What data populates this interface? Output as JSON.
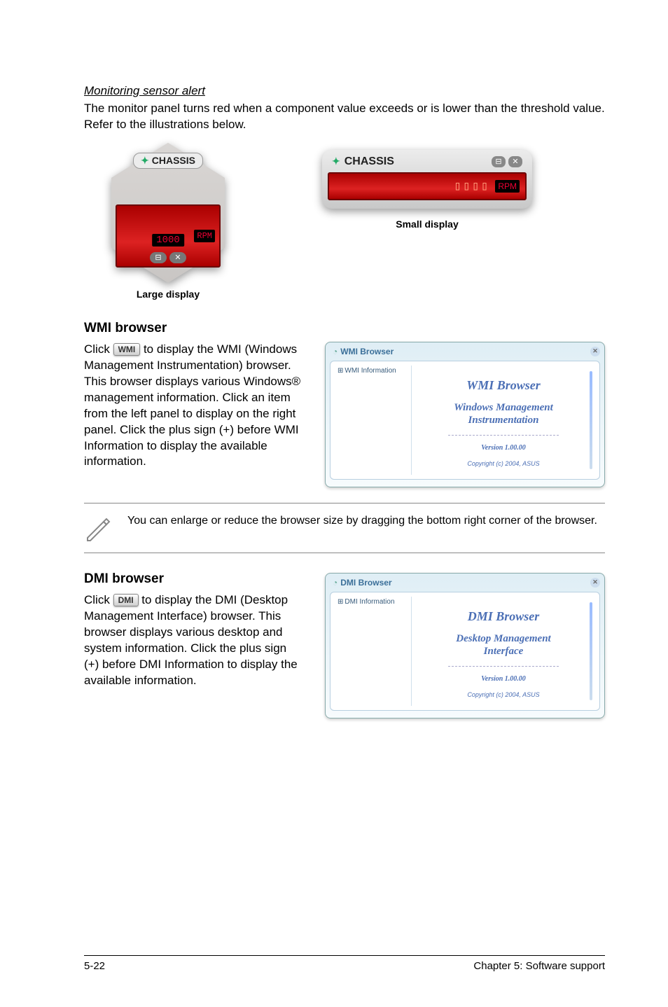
{
  "monitoring": {
    "heading": "Monitoring sensor alert",
    "desc": "The monitor panel turns red when a component value exceeds or is lower than the threshold value. Refer to the illustrations below.",
    "large_label": "CHASSIS",
    "large_rpm_label": "RPM",
    "large_value": "1000",
    "large_caption": "Large display",
    "small_label": "CHASSIS",
    "small_rpm_label": "RPM",
    "small_caption": "Small display"
  },
  "wmi": {
    "heading": "WMI browser",
    "desc1": "Click ",
    "btn": "WMI",
    "desc2": " to display the WMI (Windows Management Instrumentation) browser. This browser displays various Windows® management information. Click an item from the left panel to display on the right panel. Click the plus sign (+) before WMI Information to display the available information.",
    "shot_title": "WMI Browser",
    "tree_root": "WMI Information",
    "main_title": "WMI Browser",
    "main_sub": "Windows Management\nInstrumentation",
    "version": "Version 1.00.00",
    "copyright": "Copyright (c) 2004, ASUS"
  },
  "note": {
    "text": "You can enlarge or reduce the browser size by dragging the bottom right corner of the browser."
  },
  "dmi": {
    "heading": "DMI browser",
    "desc1": "Click ",
    "btn": "DMI",
    "desc2": " to display the DMI (Desktop Management Interface) browser. This browser displays various desktop and system information. Click the plus sign (+) before DMI Information to display the available information.",
    "shot_title": "DMI Browser",
    "tree_root": "DMI Information",
    "main_title": "DMI Browser",
    "main_sub": "Desktop Management\nInterface",
    "version": "Version 1.00.00",
    "copyright": "Copyright (c) 2004, ASUS"
  },
  "footer": {
    "left": "5-22",
    "right": "Chapter 5: Software support"
  }
}
